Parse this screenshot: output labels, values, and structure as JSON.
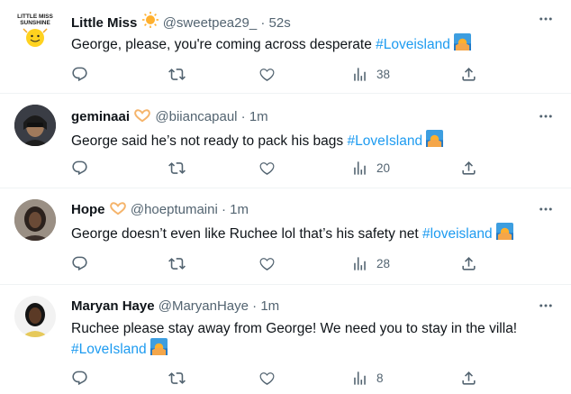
{
  "tweets": [
    {
      "name": "Little Miss",
      "handle": "@sweetpea29_",
      "time": "52s",
      "text": "George, please, you're coming across desperate ",
      "hashtag": "#Loveisland",
      "views": "38",
      "avatar_text": "LITTLE MISS SUNSHINE"
    },
    {
      "name": "geminaai",
      "handle": "@biiancapaul",
      "time": "1m",
      "text": "George said he’s not ready to pack his bags ",
      "hashtag": "#LoveIsland",
      "views": "20"
    },
    {
      "name": "Hope",
      "handle": "@hoeptumaini",
      "time": "1m",
      "text": "George doesn’t even like Ruchee lol that’s his safety net ",
      "hashtag": "#loveisland",
      "views": "28"
    },
    {
      "name": "Maryan Haye",
      "handle": "@MaryanHaye",
      "time": "1m",
      "text": "Ruchee please stay away from George! We need you to stay in the villa!",
      "hashtag": "#LoveIsland",
      "views": "8"
    }
  ],
  "separator": "·",
  "colors": {
    "accent": "#1d9bf0",
    "muted": "#536471",
    "text": "#0f1419",
    "border": "#eff3f4"
  },
  "icons": [
    "reply-icon",
    "retweet-icon",
    "like-icon",
    "views-icon",
    "share-icon",
    "more-icon",
    "island-emoji-icon",
    "sun-emoji-icon",
    "heart-hands-emoji-icon"
  ]
}
